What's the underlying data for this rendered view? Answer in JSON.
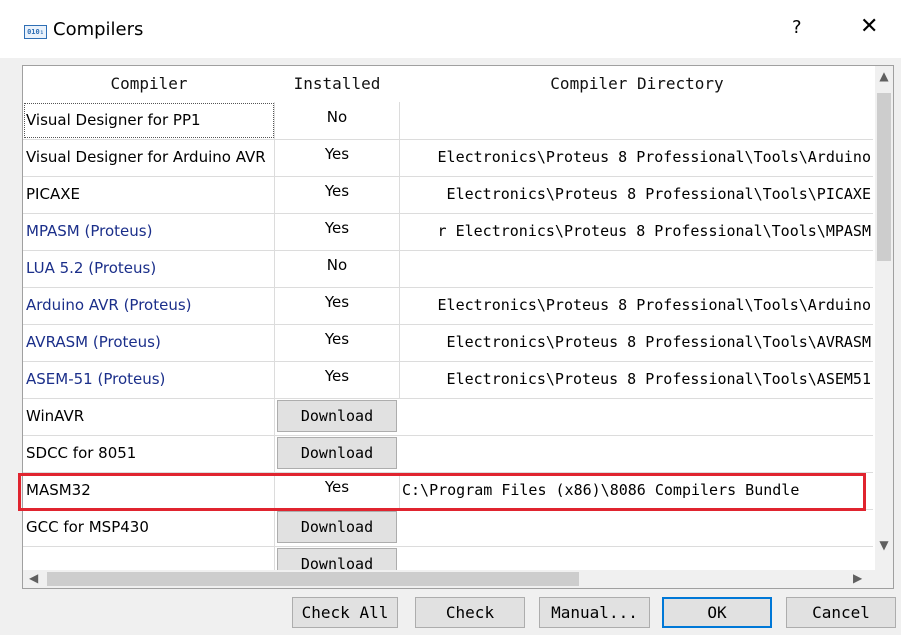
{
  "window": {
    "title": "Compilers",
    "app_icon": "binary-icon",
    "app_icon_text": "010₁",
    "help_label": "?",
    "close_label": "✕"
  },
  "table": {
    "headers": [
      "Compiler",
      "Installed",
      "Compiler Directory"
    ],
    "rows": [
      {
        "name": "Visual Designer for PP1",
        "installed": "No",
        "directory": ""
      },
      {
        "name": "Visual Designer for Arduino AVR",
        "installed": "Yes",
        "directory": "Electronics\\Proteus 8 Professional\\Tools\\Arduino"
      },
      {
        "name": "PICAXE",
        "installed": "Yes",
        "directory": "Electronics\\Proteus 8 Professional\\Tools\\PICAXE"
      },
      {
        "name": "MPASM (Proteus)",
        "installed": "Yes",
        "directory": "r Electronics\\Proteus 8 Professional\\Tools\\MPASM"
      },
      {
        "name": "LUA 5.2 (Proteus)",
        "installed": "No",
        "directory": ""
      },
      {
        "name": "Arduino AVR (Proteus)",
        "installed": "Yes",
        "directory": "Electronics\\Proteus 8 Professional\\Tools\\Arduino"
      },
      {
        "name": "AVRASM (Proteus)",
        "installed": "Yes",
        "directory": "Electronics\\Proteus 8 Professional\\Tools\\AVRASM"
      },
      {
        "name": "ASEM-51 (Proteus)",
        "installed": "Yes",
        "directory": "Electronics\\Proteus 8 Professional\\Tools\\ASEM51"
      },
      {
        "name": "WinAVR",
        "installed": "Download",
        "directory": ""
      },
      {
        "name": "SDCC for 8051",
        "installed": "Download",
        "directory": ""
      },
      {
        "name": "MASM32",
        "installed": "Yes",
        "directory": "C:\\Program Files (x86)\\8086 Compilers Bundle"
      },
      {
        "name": "GCC for MSP430",
        "installed": "Download",
        "directory": ""
      },
      {
        "name": "",
        "installed": "Download",
        "directory": ""
      }
    ]
  },
  "scrollbars": {
    "up": "▲",
    "down": "▼",
    "left": "◀",
    "right": "▶"
  },
  "buttons": {
    "check_all": "Check All",
    "check": "Check",
    "manual": "Manual...",
    "ok": "OK",
    "cancel": "Cancel"
  },
  "colors": {
    "highlight": "#e0242f",
    "link": "#1b2f8a",
    "default_button_border": "#0078d7"
  }
}
